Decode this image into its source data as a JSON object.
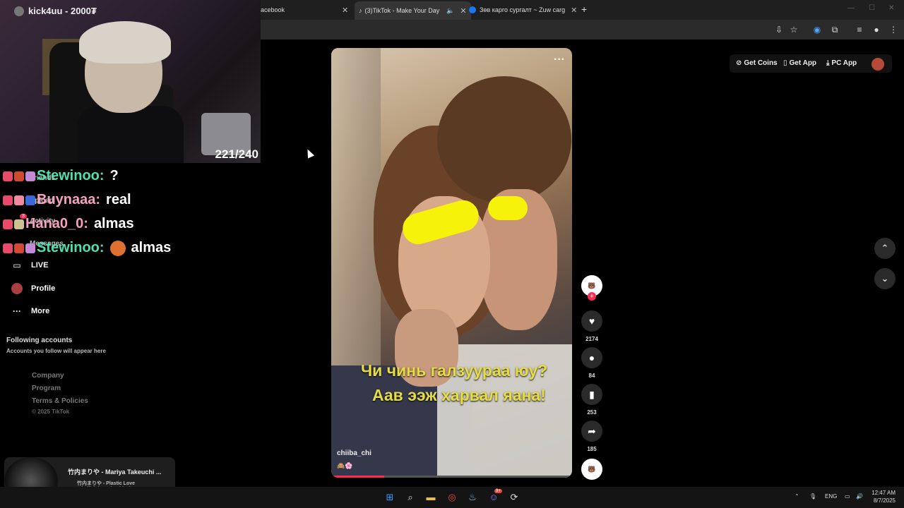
{
  "browser": {
    "tabs": [
      {
        "label": "acebook",
        "active": false
      },
      {
        "label": "(3)TikTok - Make Your Day",
        "active": true
      },
      {
        "label": "Зөв карго сургалт ~ Zuw carg",
        "active": false
      }
    ],
    "new_tab": "+"
  },
  "stream": {
    "streamer": "kick4uu - 2000₮",
    "viewer_count": "221/240"
  },
  "chat": [
    {
      "name": "Stewinoo:",
      "message": "?",
      "color": "#4fe0b0"
    },
    {
      "name": "Buynaaa:",
      "message": "real",
      "color": "#f6a0c0"
    },
    {
      "name": "Hana0_0:",
      "message": "almas",
      "color": "#f6a0c0"
    },
    {
      "name": "Stewinoo:",
      "message": "almas",
      "color": "#4fe0b0"
    }
  ],
  "sidebar": {
    "partial_items": [
      "Friends",
      "Upload",
      "Activity",
      "Messages"
    ],
    "activity_badge": "3",
    "items": [
      {
        "label": "LIVE",
        "icon": "tv-icon"
      },
      {
        "label": "Profile",
        "icon": "avatar"
      },
      {
        "label": "More",
        "icon": "ellipsis-icon"
      }
    ],
    "following_heading": "Following accounts",
    "following_sub": "Accounts you follow will appear here",
    "footer_links": [
      "Company",
      "Program",
      "Terms & Policies"
    ],
    "copyright": "© 2025 TikTok"
  },
  "header": {
    "get_coins": "Get Coins",
    "get_app": "Get App",
    "pc_app": "PC App"
  },
  "video": {
    "caption_line1": "Чи чинь галзуураа юу?",
    "caption_line2": "Аав ээж харвал яана!",
    "author": "chiiba_chi",
    "progress": 0.22,
    "more": "···"
  },
  "actions": {
    "likes": "2174",
    "comments": "84",
    "saves": "253",
    "shares": "185"
  },
  "now_playing": {
    "title": "竹内まりや - Mariya Takeuchi ...",
    "subtitle": "竹内まりや - Plastic Love (Official Music Video)"
  },
  "taskbar": {
    "language": "ENG",
    "time": "12:47 AM",
    "date": "8/7/2025",
    "discord_badge": "9+"
  }
}
